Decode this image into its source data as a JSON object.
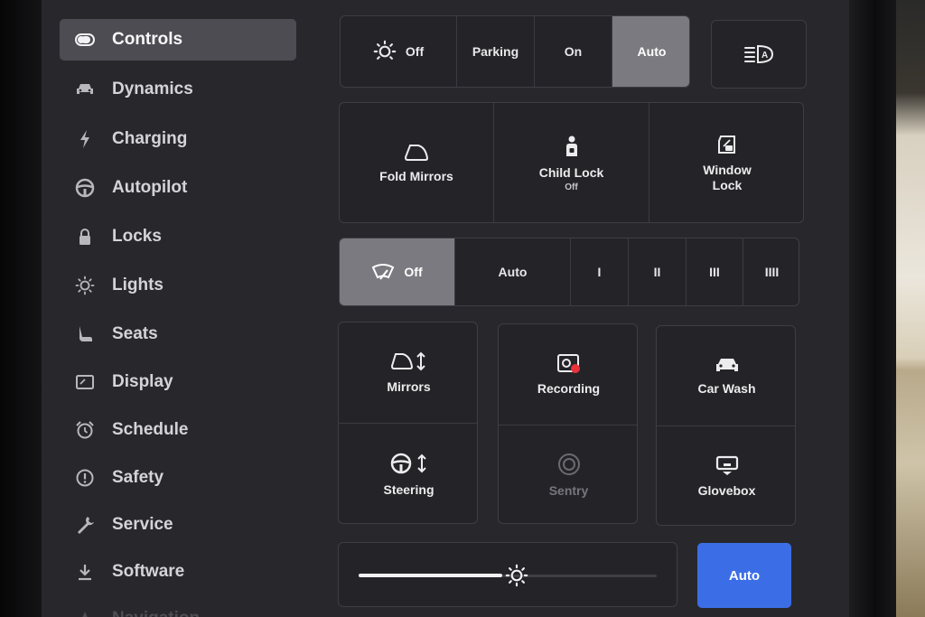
{
  "sidebar": {
    "items": [
      {
        "label": "Controls",
        "icon": "toggle-icon"
      },
      {
        "label": "Dynamics",
        "icon": "car-icon"
      },
      {
        "label": "Charging",
        "icon": "bolt-icon"
      },
      {
        "label": "Autopilot",
        "icon": "steering-wheel-icon"
      },
      {
        "label": "Locks",
        "icon": "lock-icon"
      },
      {
        "label": "Lights",
        "icon": "sun-icon"
      },
      {
        "label": "Seats",
        "icon": "seat-icon"
      },
      {
        "label": "Display",
        "icon": "display-icon"
      },
      {
        "label": "Schedule",
        "icon": "alarm-clock-icon"
      },
      {
        "label": "Safety",
        "icon": "alert-circle-icon"
      },
      {
        "label": "Service",
        "icon": "wrench-icon"
      },
      {
        "label": "Software",
        "icon": "download-icon"
      },
      {
        "label": "Navigation",
        "icon": "navigation-icon"
      }
    ],
    "active": "Controls"
  },
  "headlights": {
    "options": [
      "Off",
      "Parking",
      "On",
      "Auto"
    ],
    "selected": "Auto",
    "auto_high_beam_icon": "auto-high-beam-icon"
  },
  "body_controls": {
    "fold_mirrors": "Fold Mirrors",
    "child_lock": "Child Lock",
    "child_lock_state": "Off",
    "window_lock": "Window Lock"
  },
  "wipers": {
    "options": [
      "Off",
      "Auto",
      "I",
      "II",
      "III",
      "IIII"
    ],
    "selected": "Off"
  },
  "tiles": {
    "mirrors": "Mirrors",
    "recording": "Recording",
    "car_wash": "Car Wash",
    "steering": "Steering",
    "sentry": "Sentry",
    "glovebox": "Glovebox"
  },
  "brightness": {
    "level": 0.53,
    "auto_label": "Auto"
  },
  "colors": {
    "accent": "#3b6ee6",
    "selected_segment": "#7b7a80",
    "recording_dot": "#e8323c"
  }
}
